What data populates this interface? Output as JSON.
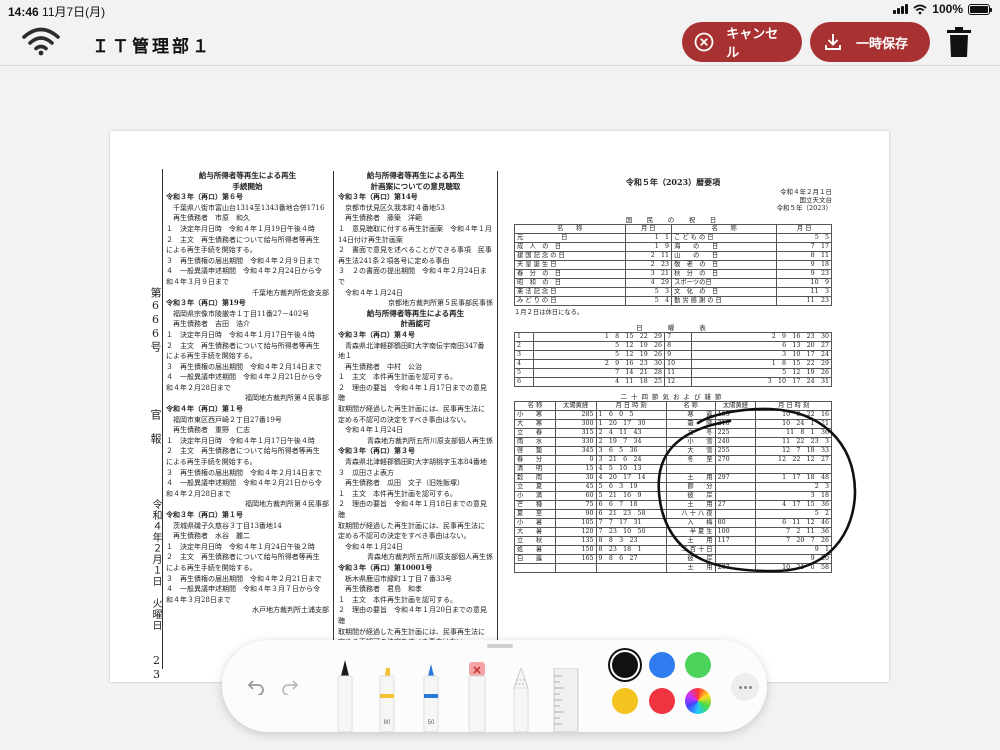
{
  "status": {
    "time": "14:46",
    "date": "11月7日(月)",
    "battery": "100%"
  },
  "toolbar": {
    "title": "ＩＴ管理部１",
    "cancel_label": "キャンセル",
    "save_label": "一時保存"
  },
  "document": {
    "side": {
      "number": "第666号",
      "paper": "官　報",
      "date": "令和４年２月１日　火曜日",
      "page": "23"
    },
    "col1": [
      {
        "t": "h",
        "s": "給与所得者等再生による再生"
      },
      {
        "t": "h",
        "s": "手続開始"
      },
      {
        "t": "b",
        "s": "令和３年（再ロ）第６号"
      },
      {
        "s": "　千葉県八街市富山台1314至1343番地合併1716"
      },
      {
        "s": "　再生債務者　市原　和久"
      },
      {
        "s": "１　決定年月日時　令和４年１月19日午後４時"
      },
      {
        "s": "２　主文　再生債務者について給与所得者等再生"
      },
      {
        "s": "による再生手続を開始する。"
      },
      {
        "s": "３　再生債権の届出期間　令和４年２月９日まで"
      },
      {
        "s": "４　一般異議申述期間　令和４年２月24日から令"
      },
      {
        "s": "和４年３月９日まで"
      },
      {
        "t": "r",
        "s": "千葉地方裁判所佐倉支部"
      },
      {
        "t": "b",
        "s": "令和３年（再ロ）第19号"
      },
      {
        "s": "　福岡県宗像市陵厳寺１丁目11番27－402号"
      },
      {
        "s": "　再生債務者　吉田　浩介"
      },
      {
        "s": "１　決定年月日時　令和４年１月17日午後４時"
      },
      {
        "s": "２　主文　再生債務者について給与所得者等再生"
      },
      {
        "s": "による再生手続を開始する。"
      },
      {
        "s": "３　再生債権の届出期間　令和４年２月14日まで"
      },
      {
        "s": "４　一般異議申述期間　令和４年２月21日から令"
      },
      {
        "s": "和４年２月28日まで"
      },
      {
        "t": "r",
        "s": "福岡地方裁判所第４民事部"
      },
      {
        "t": "b",
        "s": "令和４年（再ロ）第１号"
      },
      {
        "s": "　福岡市東区西戸崎２丁目27番19号"
      },
      {
        "s": "　再生債務者　重野　仁志"
      },
      {
        "s": "１　決定年月日時　令和４年１月17日午後４時"
      },
      {
        "s": "２　主文　再生債務者について給与所得者等再生"
      },
      {
        "s": "による再生手続を開始する。"
      },
      {
        "s": "３　再生債権の届出期間　令和４年２月14日まで"
      },
      {
        "s": "４　一般異議申述期間　令和４年２月21日から令"
      },
      {
        "s": "和４年２月28日まで"
      },
      {
        "t": "r",
        "s": "福岡地方裁判所第４民事部"
      },
      {
        "t": "b",
        "s": "令和３年（再ロ）第１号"
      },
      {
        "s": "　茨城県磯子久慈谷３丁目13番地14"
      },
      {
        "s": "　再生債務者　水谷　麗二"
      },
      {
        "s": "１　決定年月日時　令和４年１月24日午後２時"
      },
      {
        "s": "２　主文　再生債務者について給与所得者等再生"
      },
      {
        "s": "による再生手続を開始する。"
      },
      {
        "s": "３　再生債権の届出期間　令和４年２月21日まで"
      },
      {
        "s": "４　一般異議申述期間　令和４年３月７日から令"
      },
      {
        "s": "和４年３月28日まで"
      },
      {
        "t": "r",
        "s": "水戸地方裁判所土浦支部"
      }
    ],
    "col2": [
      {
        "t": "h",
        "s": "給与所得者等再生による再生"
      },
      {
        "t": "h",
        "s": "計画案についての意見聴取"
      },
      {
        "t": "b",
        "s": "令和３年（再ロ）第14号"
      },
      {
        "s": "　京都市伏見区久我本町４番地53"
      },
      {
        "s": "　再生債務者　藤築　洋範"
      },
      {
        "s": "１　意見聴取に付する再生計画案　令和４年１月"
      },
      {
        "s": "14日付け再生計画案"
      },
      {
        "s": "２　書面で意見を述べることができる事項　民事"
      },
      {
        "s": "再生法241条２項各号に定める事由"
      },
      {
        "s": "３　２の書面の提出期間　令和４年２月24日まで"
      },
      {
        "s": "　令和４年１月24日"
      },
      {
        "t": "r",
        "s": "京都地方裁判所第５民事部民事係"
      },
      {
        "t": "h",
        "s": "給与所得者等再生による再生"
      },
      {
        "t": "h",
        "s": "計画認可"
      },
      {
        "t": "b",
        "s": "令和３年（再ロ）第４号"
      },
      {
        "s": "　青森県北津軽郡鶴田町大字南伝宇南田347番"
      },
      {
        "s": "地１"
      },
      {
        "s": "　再生債務者　中村　公治"
      },
      {
        "s": "１　主文　本件再生計画を認可する。"
      },
      {
        "s": "２　理由の要旨　令和４年１月17日までの意見聴"
      },
      {
        "s": "取期間が経過した再生計画には、民事再生法に"
      },
      {
        "s": "定める不認可の決定をすべき事由はない。"
      },
      {
        "s": "　令和４年１月24日"
      },
      {
        "t": "r",
        "s": "青森地方裁判所五所川原支部個人再生係"
      },
      {
        "t": "b",
        "s": "令和３年（再ロ）第３号"
      },
      {
        "s": "　青森県北津軽郡鶴田町大字胡桃字玉本84番地"
      },
      {
        "s": "３　瓜田さよ表方"
      },
      {
        "s": "　再生債務者　瓜田　文子（旧姓飯塚）"
      },
      {
        "s": "１　主文　本件再生計画を認可する。"
      },
      {
        "s": "２　理由の要旨　令和４年１月18日までの意見聴"
      },
      {
        "s": "取期間が経過した再生計画には、民事再生法に"
      },
      {
        "s": "定める不認可の決定をすべき事由はない。"
      },
      {
        "s": "　令和４年１月24日"
      },
      {
        "t": "r",
        "s": "青森地方裁判所五所川原支部個人再生係"
      },
      {
        "t": "b",
        "s": "令和３年（再ロ）第10001号"
      },
      {
        "s": "　栃木県鹿沼市緑町１丁目７番33号"
      },
      {
        "s": "　再生債務者　君島　和孝"
      },
      {
        "s": "１　主文　本件再生計画を認可する。"
      },
      {
        "s": "２　理由の要旨　令和４年１月20日までの意見聴"
      },
      {
        "s": "取期間が経過した再生計画には、民事再生法に"
      },
      {
        "s": "定める不認可の決定をすべき事由はない。"
      },
      {
        "s": "　令和４年１月21日"
      },
      {
        "t": "r",
        "s": "宇都宮地方裁判所第１民事部"
      }
    ],
    "reki": {
      "heading": "令和５年（2023）暦要項",
      "meta": [
        "令和４年２月１日",
        "国立天文台",
        "令和５年（2023）"
      ],
      "shukujitsu_caption": "国　民　の　祝　日",
      "shukujitsu_head": [
        "名　　称",
        "月 日",
        "名　　称",
        "月 日"
      ],
      "shukujitsu": [
        [
          "元　　　　　　日",
          "1　1",
          "こ ど も の 日",
          "5　5"
        ],
        [
          "成　人　の　日",
          "1　9",
          "海　　の　　日",
          "7　17"
        ],
        [
          "建 国 記 念 の 日",
          "2　11",
          "山　　の　　日",
          "8　11"
        ],
        [
          "天 皇 誕 生 日",
          "2　23",
          "敬　老　の　日",
          "9　18"
        ],
        [
          "春　分　の　日",
          "3　21",
          "秋　分　の　日",
          "9　23"
        ],
        [
          "昭　和　の　日",
          "4　29",
          "スポーツの日",
          "10　9"
        ],
        [
          "憲 法 記 念 日",
          "5　3",
          "文　化　の　日",
          "11　3"
        ],
        [
          "み ど り の 日",
          "5　4",
          "勤 労 感 謝 の 日",
          "11　23"
        ]
      ],
      "note": "１月２日は休日になる。",
      "nichiyo_caption": "日　　曜　　表",
      "nichiyo": [
        [
          "1",
          "1　8　15　22　29",
          "7",
          "2　9　16　23　30"
        ],
        [
          "2",
          "5　12　19　26",
          "8",
          "6　13　20　27"
        ],
        [
          "3",
          "5　12　19　26",
          "9",
          "3　10　17　24"
        ],
        [
          "4",
          "2　9　16　23　30",
          "10",
          "1　8　15　22　29"
        ],
        [
          "5",
          "7　14　21　28",
          "11",
          "5　12　19　26"
        ],
        [
          "6",
          "4　11　18　25",
          "12",
          "3　10　17　24　31"
        ]
      ],
      "sekki_caption": "二十四節気および雑節",
      "sekki_head": [
        "名 称",
        "太陽黄経",
        "月 日 時 刻",
        "名 称",
        "太陽黄経",
        "月 日 時 刻"
      ],
      "sekki": [
        [
          "小　　寒",
          "285",
          "1　6　0　5",
          "寒　　露",
          "195",
          "10　8　22　16"
        ],
        [
          "大　　寒",
          "300",
          "1　20　17　30",
          "霜　　降",
          "210",
          "10　24　1　21"
        ],
        [
          "立　　春",
          "315",
          "2　4　11　43",
          "立　　冬",
          "225",
          "11　8　1　36"
        ],
        [
          "雨　　水",
          "330",
          "2　19　7　34",
          "小　　雪",
          "240",
          "11　22　23　3"
        ],
        [
          "啓　　蟄",
          "345",
          "3　6　5　36",
          "大　　雪",
          "255",
          "12　7　18　33"
        ],
        [
          "春　　分",
          "0",
          "3　21　6　24",
          "冬　　至",
          "270",
          "12　22　12　27"
        ],
        [
          "清　　明",
          "15",
          "4　5　10　13",
          "",
          "",
          ""
        ],
        [
          "穀　　雨",
          "30",
          "4　20　17　14",
          "土　　用",
          "297",
          "1　17　18　48"
        ],
        [
          "立　　夏",
          "45",
          "5　6　3　19",
          "節　　分",
          "",
          "2　3"
        ],
        [
          "小　　満",
          "60",
          "5　21　16　9",
          "彼　　岸",
          "",
          "3　18"
        ],
        [
          "芒　　種",
          "75",
          "6　6　7　18",
          "土　　用",
          "27",
          "4　17　15　36"
        ],
        [
          "夏　　至",
          "90",
          "6　21　23　58",
          "八 十 八 夜",
          "",
          "5　2"
        ],
        [
          "小　　暑",
          "105",
          "7　7　17　31",
          "入　　梅",
          "80",
          "6　11　12　46"
        ],
        [
          "大　　暑",
          "120",
          "7　23　10　50",
          "半 夏 生",
          "100",
          "7　2　11　36"
        ],
        [
          "立　　秋",
          "135",
          "8　8　3　23",
          "土　　用",
          "117",
          "7　20　7　26"
        ],
        [
          "処　　暑",
          "150",
          "8　23　18　1",
          "二 百 十 日",
          "",
          "9　1"
        ],
        [
          "白　　露",
          "165",
          "9　8　6　27",
          "彼　　岸",
          "",
          "9　20"
        ],
        [
          "",
          "",
          "",
          "土　　用",
          "207",
          "10　21　0　58"
        ]
      ]
    }
  },
  "palette": {
    "undo": "undo",
    "redo": "redo",
    "highlighter_width": "80",
    "marker_width": "50",
    "colors": [
      "#111111",
      "#2f7bf0",
      "#4cd35c",
      "#f5c31d",
      "#ef3340"
    ]
  }
}
